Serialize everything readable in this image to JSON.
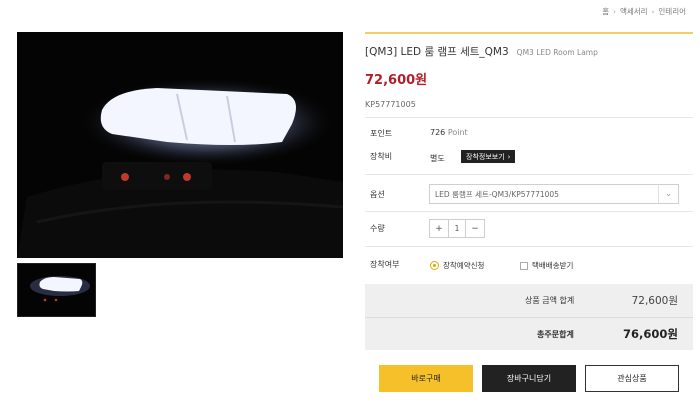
{
  "breadcrumb": {
    "home": "홈",
    "category": "액세서리",
    "subcategory": "인테리어"
  },
  "product": {
    "title": "[QM3] LED 룸 램프 세트_QM3",
    "subtitle": "QM3 LED Room Lamp",
    "price": "72,600원",
    "code": "KP57771005"
  },
  "details": {
    "point_label": "포인트",
    "point_value": "726",
    "point_unit": "Point",
    "install_fee_label": "장착비",
    "install_fee_value": "별도",
    "install_info_button": "장착정보보기"
  },
  "option": {
    "label": "옵션",
    "selected": "LED 룸램프 세트-QM3/KP57771005"
  },
  "quantity": {
    "label": "수량",
    "minus": "+",
    "value": "1",
    "plus": "−"
  },
  "install": {
    "label": "장착여부",
    "option1": "장착예약신청",
    "option2": "택배배송받기"
  },
  "totals": {
    "product_total_label": "상품 금액 합계",
    "product_total_value": "72,600원",
    "order_total_label": "총주문합계",
    "order_total_value": "76,600원"
  },
  "buttons": {
    "buy": "바로구매",
    "cart": "장바구니담기",
    "wishlist": "관심상품"
  },
  "colors": {
    "accent": "#f5c02a",
    "price": "#b0202a",
    "dark": "#222222"
  }
}
